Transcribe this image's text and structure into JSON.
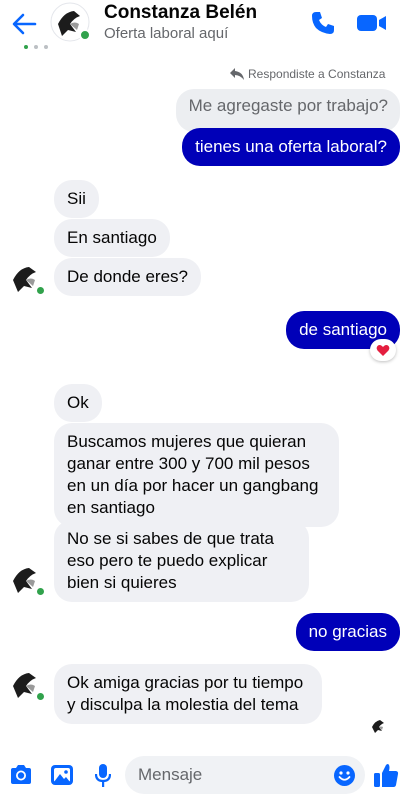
{
  "header": {
    "name": "Constanza Belén",
    "subtitle": "Oferta laboral aquí"
  },
  "reply_note": "Respondiste a Constanza",
  "quoted_message": "Me agregaste por trabajo?",
  "messages": [
    {
      "from": "me",
      "text": "tienes una oferta laboral?"
    },
    {
      "from": "them",
      "text": "Sii"
    },
    {
      "from": "them",
      "text": "En santiago"
    },
    {
      "from": "them",
      "text": "De donde eres?"
    },
    {
      "from": "me",
      "text": "de santiago",
      "reaction": "heart"
    },
    {
      "from": "them",
      "text": "Ok"
    },
    {
      "from": "them",
      "text": "Buscamos mujeres que quieran ganar entre 300 y 700 mil pesos en un día por hacer un gangbang en santiago"
    },
    {
      "from": "them",
      "text": "No se si sabes de que trata eso pero te puedo explicar bien si quieres"
    },
    {
      "from": "me",
      "text": "no gracias"
    },
    {
      "from": "them",
      "text": "Ok amiga gracias por tu tiempo y disculpa la molestia del tema"
    }
  ],
  "composer": {
    "placeholder": "Mensaje"
  },
  "colors": {
    "accent": "#0866ff",
    "outgoing_bubble": "#0000b8",
    "incoming_bubble": "#eff0f4",
    "online": "#31a24c"
  },
  "icons": [
    "back-arrow-icon",
    "phone-icon",
    "video-camera-icon",
    "camera-icon",
    "image-icon",
    "microphone-icon",
    "emoji-icon",
    "thumbs-up-icon",
    "reply-arrow-icon",
    "heart-icon"
  ]
}
